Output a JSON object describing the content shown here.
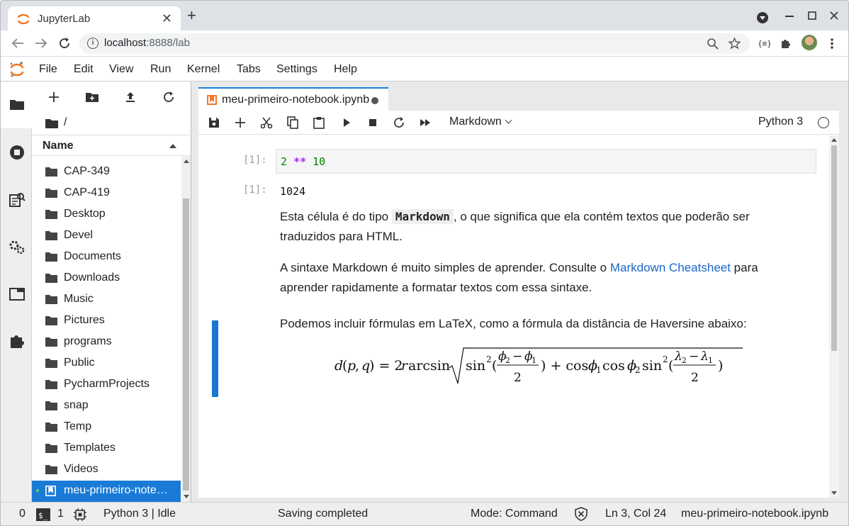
{
  "browser": {
    "tab_title": "JupyterLab",
    "new_tab": "+",
    "close": "✕",
    "url_host": "localhost",
    "url_rest": ":8888/lab",
    "ext_label": "{≡}"
  },
  "menu": {
    "items": [
      "File",
      "Edit",
      "View",
      "Run",
      "Kernel",
      "Tabs",
      "Settings",
      "Help"
    ]
  },
  "filebrowser": {
    "path": "/",
    "header": "Name",
    "items": [
      {
        "name": "CAP-349",
        "type": "folder"
      },
      {
        "name": "CAP-419",
        "type": "folder"
      },
      {
        "name": "Desktop",
        "type": "folder"
      },
      {
        "name": "Devel",
        "type": "folder"
      },
      {
        "name": "Documents",
        "type": "folder"
      },
      {
        "name": "Downloads",
        "type": "folder"
      },
      {
        "name": "Music",
        "type": "folder"
      },
      {
        "name": "Pictures",
        "type": "folder"
      },
      {
        "name": "programs",
        "type": "folder"
      },
      {
        "name": "Public",
        "type": "folder"
      },
      {
        "name": "PycharmProjects",
        "type": "folder"
      },
      {
        "name": "snap",
        "type": "folder"
      },
      {
        "name": "Temp",
        "type": "folder"
      },
      {
        "name": "Templates",
        "type": "folder"
      },
      {
        "name": "Videos",
        "type": "folder"
      },
      {
        "name": "meu-primeiro-note…",
        "type": "notebook",
        "selected": true
      }
    ]
  },
  "notebook": {
    "tab_name": "meu-primeiro-notebook.ipynb",
    "cell_type": "Markdown",
    "kernel": "Python 3",
    "cells": {
      "in_prompt": "[1]:",
      "out_prompt": "[1]:",
      "code_a": "2",
      "code_op": "**",
      "code_b": "10",
      "output": "1024",
      "md1_before": "Esta célula é do tipo ",
      "md1_code": "Markdown",
      "md1_after": ", o que significa que ela contém textos que poderão ser traduzidos para HTML.",
      "md2_before": "A sintaxe Markdown é muito simples de aprender. Consulte o ",
      "md2_link": "Markdown Cheatsheet",
      "md2_after": " para aprender rapidamente a formatar textos com essa sintaxe.",
      "md3": "Podemos incluir fórmulas em LaTeX, como a fórmula da distância de Haversine abaixo:"
    }
  },
  "statusbar": {
    "terminals": "0",
    "kernels": "1",
    "kernel_status": "Python 3 | Idle",
    "message": "Saving completed",
    "mode": "Mode: Command",
    "cursor": "Ln 3, Col 24",
    "filename": "meu-primeiro-notebook.ipynb"
  },
  "colors": {
    "accent": "#1976d2",
    "jupyter_orange": "#f37726",
    "selection": "#1a7bd6"
  }
}
